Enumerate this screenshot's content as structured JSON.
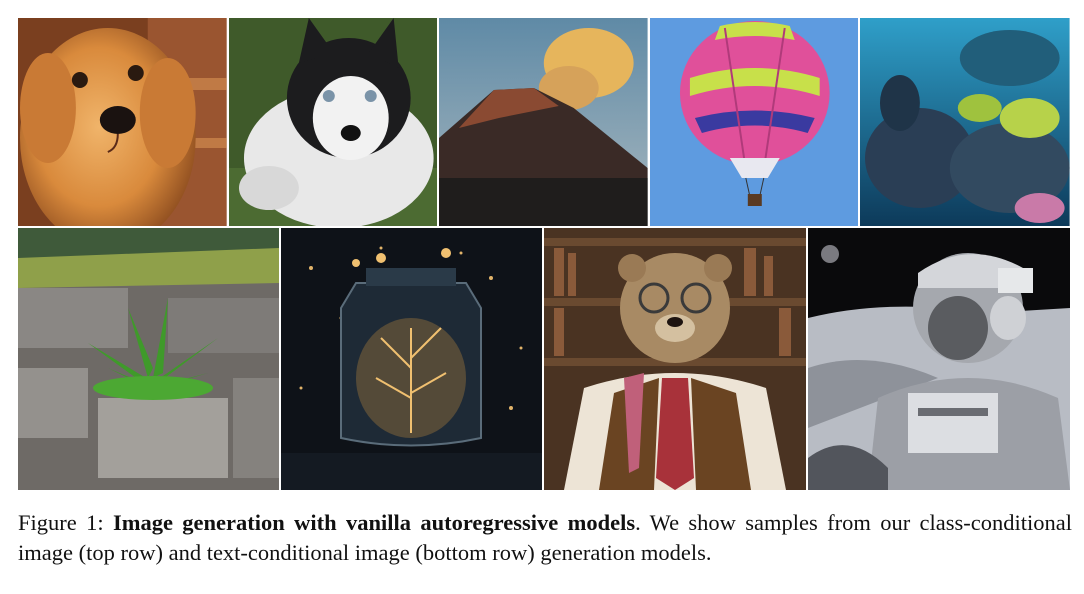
{
  "figure": {
    "label": "Figure 1:",
    "title": "Image generation with vanilla autoregressive models",
    "after_title": ".",
    "text": "We show samples from our class-conditional image (top row) and text-conditional image (bottom row) generation models."
  },
  "rows": [
    {
      "name": "top-row",
      "images": [
        "golden-retriever-puppy",
        "husky-puppy",
        "volcano",
        "hot-air-balloon",
        "coral-reef"
      ]
    },
    {
      "name": "bottom-row",
      "images": [
        "sprout-in-pavement",
        "glowing-jar",
        "bear-in-vest",
        "astronaut-on-moon"
      ]
    }
  ]
}
